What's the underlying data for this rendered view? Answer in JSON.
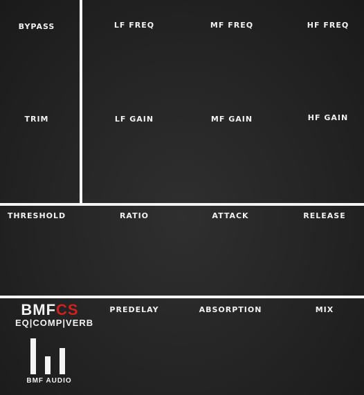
{
  "eq": {
    "bypass": "BYPASS",
    "trim": "TRIM",
    "lf_freq": "LF FREQ",
    "mf_freq": "MF FREQ",
    "hf_freq": "HF FREQ",
    "lf_gain": "LF GAIN",
    "mf_gain": "MF GAIN",
    "hf_gain": "HF GAIN"
  },
  "comp": {
    "threshold": "THRESHOLD",
    "ratio": "RATIO",
    "attack": "ATTACK",
    "release": "RELEASE"
  },
  "verb": {
    "predelay": "PREDELAY",
    "absorption": "ABSORPTION",
    "mix": "MIX"
  },
  "brand": {
    "title_main": "BMF",
    "title_accent": "CS",
    "subtitle": "EQ|COMP|VERB",
    "company": "BMF AUDIO",
    "accent_color": "#d0201f"
  }
}
